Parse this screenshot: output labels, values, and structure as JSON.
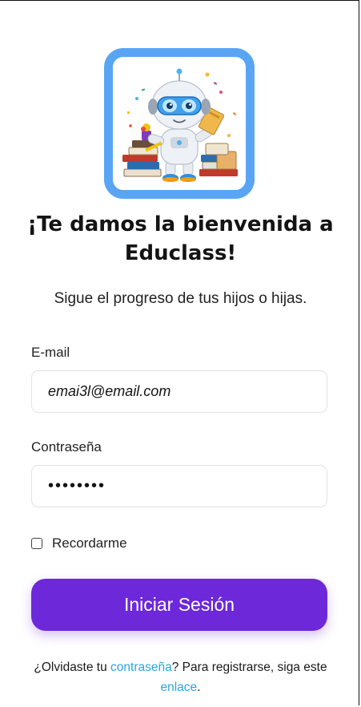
{
  "logo": {
    "icon": "robot-teacher-icon",
    "border_color": "#5aa5f3"
  },
  "header": {
    "title": "¡Te damos la bienvenida a Educlass!",
    "subtitle": "Sigue el progreso de tus hijos o hijas."
  },
  "form": {
    "email_label": "E-mail",
    "email_value": "emai3l@email.com",
    "password_label": "Contraseña",
    "password_value": "••••••••",
    "remember_label": "Recordarme",
    "remember_checked": false,
    "submit_label": "Iniciar Sesión",
    "submit_color": "#6d28d9"
  },
  "footer": {
    "text_before_link1": "¿Olvidaste tu ",
    "link1_label": "contraseña",
    "text_between": "? Para registrarse, siga este ",
    "link2_label": "enlace",
    "text_after": ".",
    "link_color": "#2aa6e0"
  }
}
